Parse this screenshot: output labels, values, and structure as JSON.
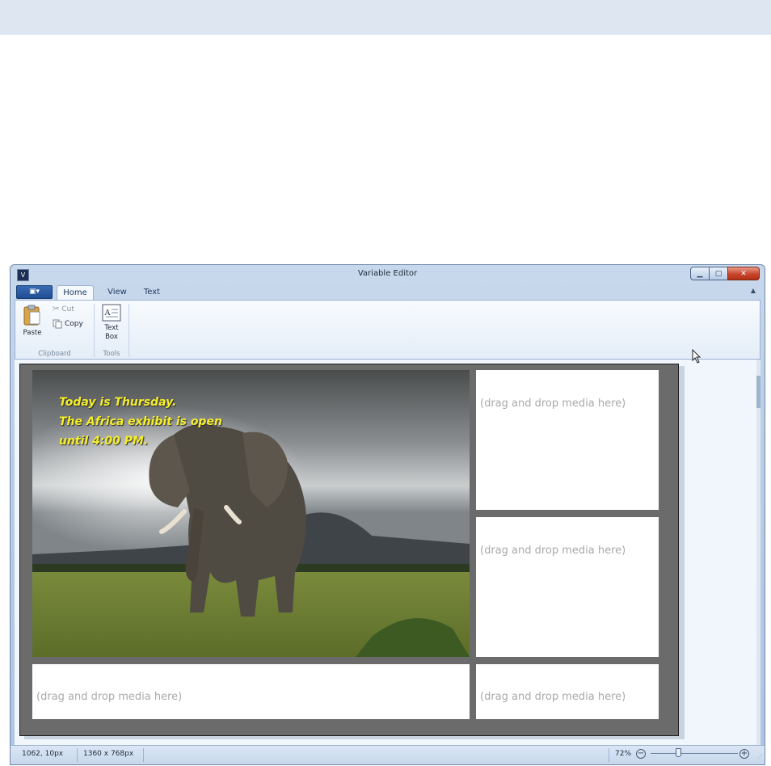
{
  "window": {
    "title": "Variable Editor"
  },
  "ribbon": {
    "tabs": [
      "Home",
      "View",
      "Text"
    ],
    "active_tab": "Home",
    "groups": {
      "clipboard": {
        "label": "Clipboard",
        "paste": "Paste",
        "cut": "Cut",
        "copy": "Copy"
      },
      "tools": {
        "label": "Tools",
        "text_box": "Text Box"
      }
    }
  },
  "canvas": {
    "main_zone": {
      "overlay_lines": [
        "Today is Thursday.",
        "The Africa exhibit is open",
        "until 4:00 PM."
      ],
      "text_color": "#f5ee2a"
    },
    "empty_zone_text": "(drag and drop media here)"
  },
  "statusbar": {
    "cursor_position": "1062, 10px",
    "resolution": "1360 x 768px",
    "zoom": "72%"
  }
}
